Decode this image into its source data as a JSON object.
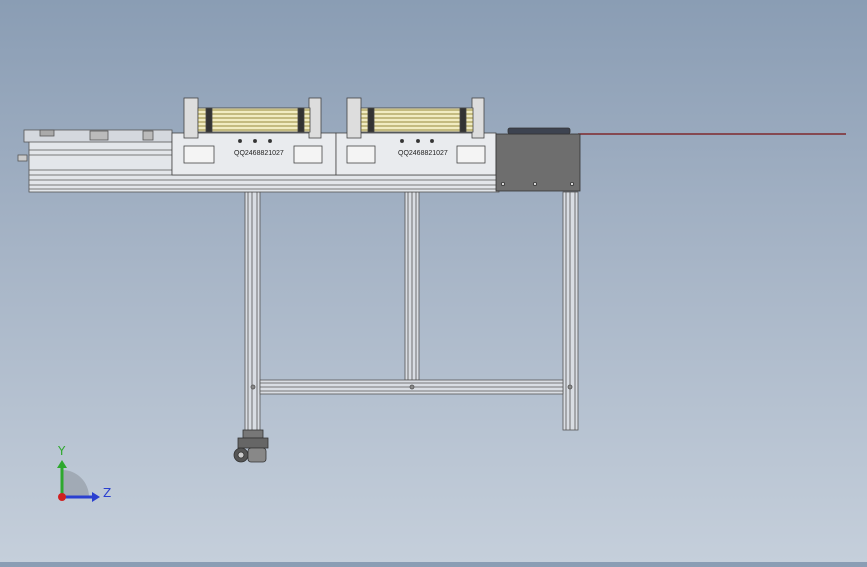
{
  "viewport": {
    "background": "gradient-blue-gray",
    "model_labels": {
      "left": "QQ2468821027",
      "right": "QQ2468821027"
    }
  },
  "triad": {
    "y_label": "Y",
    "z_label": "Z",
    "colors": {
      "y": "#2ea82e",
      "z": "#2a3fd0",
      "x": "#d02020"
    }
  }
}
